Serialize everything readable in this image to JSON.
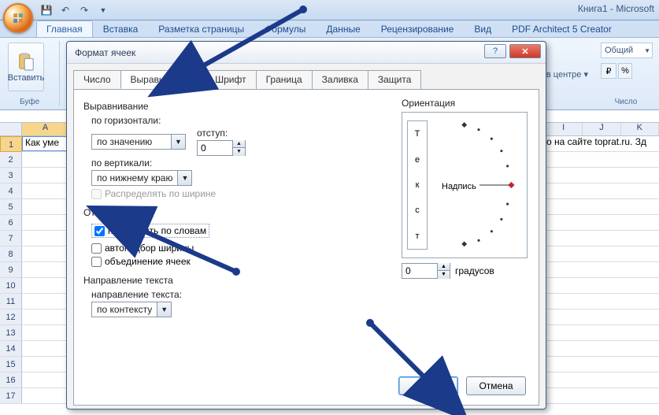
{
  "window": {
    "title": "Книга1 - Microsoft"
  },
  "qat": {
    "save_tip": "Сохранить",
    "undo_tip": "Отменить",
    "redo_tip": "Вернуть"
  },
  "ribbon_tabs": [
    "Главная",
    "Вставка",
    "Разметка страницы",
    "Формулы",
    "Данные",
    "Рецензирование",
    "Вид",
    "PDF Architect 5 Creator"
  ],
  "ribbon": {
    "paste_label": "Вставить",
    "clipboard_group": "Буфе",
    "number_format": "Общий",
    "align_center_frag": "в центре ▾",
    "number_group": "Число"
  },
  "sheet": {
    "visible_col_left": "A",
    "a1_value": "Как уме",
    "right_text": "о на сайте toprat.ru. Зд",
    "right_cols": [
      "I",
      "J",
      "K"
    ],
    "row_numbers": [
      "1",
      "2",
      "3",
      "4",
      "5",
      "6",
      "7",
      "8",
      "9",
      "10",
      "11",
      "12",
      "13",
      "14",
      "15",
      "16",
      "17"
    ]
  },
  "dialog": {
    "title": "Формат ячеек",
    "help": "?",
    "close": "✕",
    "tabs": [
      "Число",
      "Выравнивание",
      "Шрифт",
      "Граница",
      "Заливка",
      "Защита"
    ],
    "active_tab": "Выравнивание",
    "align": {
      "section": "Выравнивание",
      "h_label": "по горизонтали:",
      "h_value": "по значению",
      "indent_label": "отступ:",
      "indent_value": "0",
      "v_label": "по вертикали:",
      "v_value": "по нижнему краю",
      "justify_distributed": "Распределять по ширине"
    },
    "display": {
      "section": "Отображение",
      "wrap": "переносить по словам",
      "shrink": "автоподбор ширины",
      "merge": "объединение ячеек"
    },
    "textdir": {
      "section": "Направление текста",
      "label": "направление текста:",
      "value": "по контексту"
    },
    "orientation": {
      "section": "Ориентация",
      "vertical_word": "Текст",
      "caption": "Надпись",
      "deg_value": "0",
      "deg_label": "градусов"
    },
    "buttons": {
      "ok": "ОК",
      "cancel": "Отмена"
    }
  }
}
